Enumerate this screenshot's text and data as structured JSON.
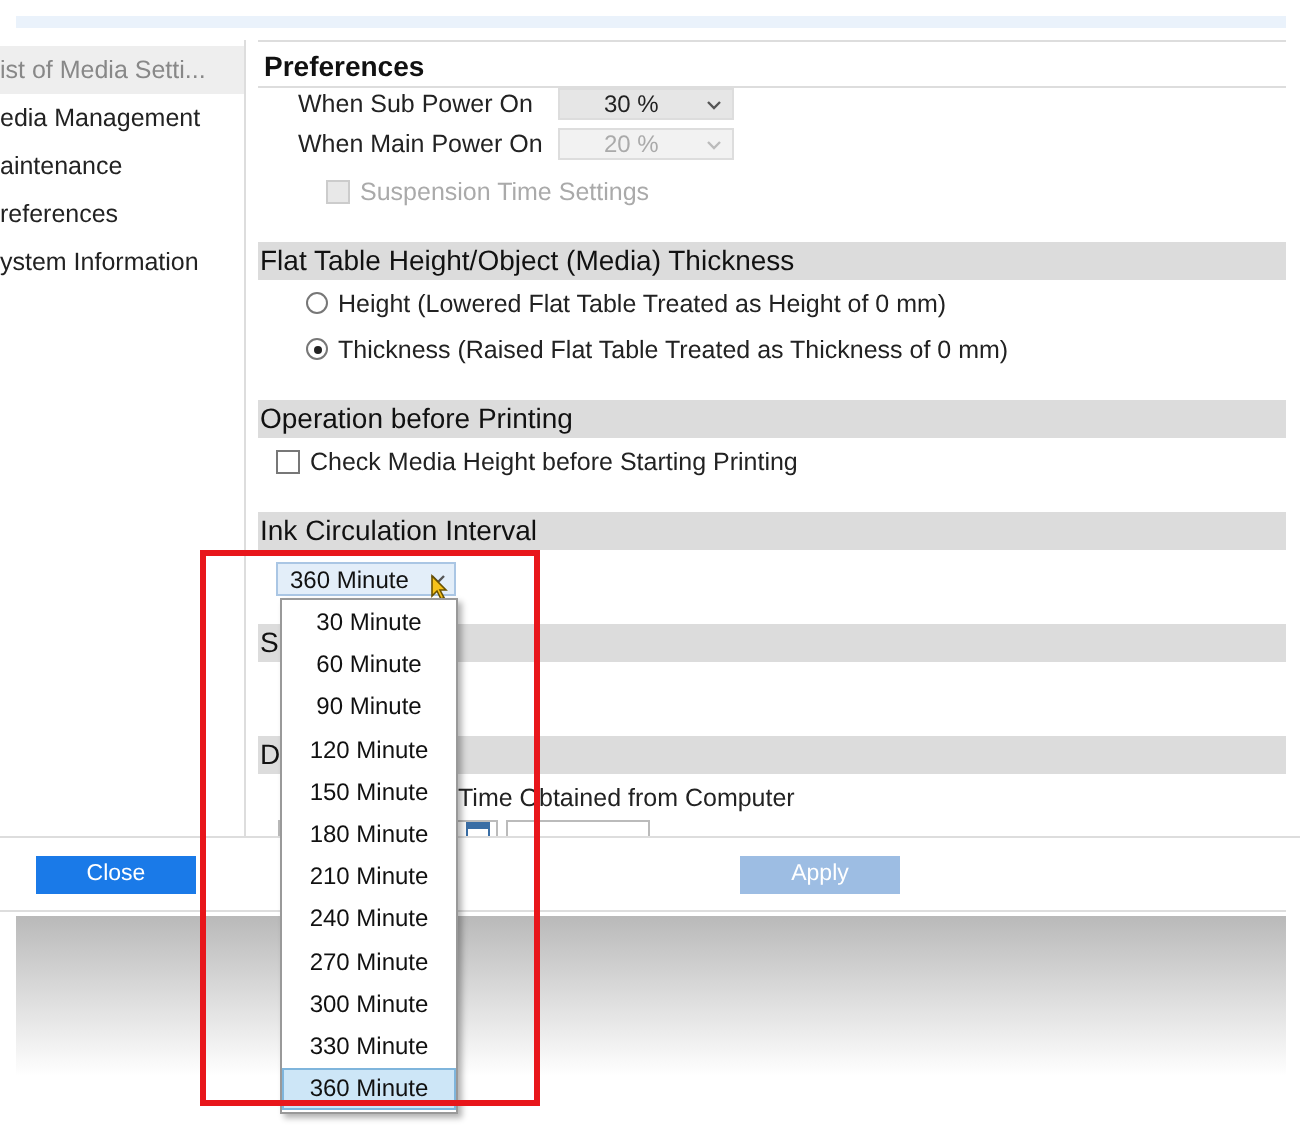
{
  "sidebar": {
    "items": [
      {
        "label": "ist of Media Setti...",
        "selected": true
      },
      {
        "label": "edia Management",
        "selected": false
      },
      {
        "label": "aintenance",
        "selected": false
      },
      {
        "label": "references",
        "selected": false
      },
      {
        "label": "ystem Information",
        "selected": false
      }
    ]
  },
  "panel": {
    "title": "Preferences",
    "power_rows": [
      {
        "label": "When Sub Power On",
        "value": "30 %",
        "disabled": false
      },
      {
        "label": "When Main Power On",
        "value": "20 %",
        "disabled": true
      }
    ],
    "suspension": {
      "label": "Suspension Time Settings",
      "checked": false,
      "disabled": true
    },
    "sections": [
      {
        "title": "Flat Table Height/Object (Media) Thickness",
        "kind": "radios",
        "options": [
          {
            "label": "Height (Lowered Flat Table Treated as Height of 0 mm)",
            "selected": false
          },
          {
            "label": "Thickness (Raised Flat Table Treated as Thickness of 0 mm)",
            "selected": true
          }
        ]
      },
      {
        "title": "Operation before Printing",
        "kind": "checkbox",
        "options": [
          {
            "label": "Check Media Height before Starting Printing",
            "checked": false
          }
        ]
      },
      {
        "title": "Ink Circulation Interval",
        "kind": "select",
        "value": "360 Minute",
        "expanded": true,
        "options": [
          {
            "label": "30 Minute",
            "selected": false
          },
          {
            "label": "60 Minute",
            "selected": false
          },
          {
            "label": "90 Minute",
            "selected": false
          },
          {
            "label": "120 Minute",
            "selected": false
          },
          {
            "label": "150 Minute",
            "selected": false
          },
          {
            "label": "180 Minute",
            "selected": false
          },
          {
            "label": "210 Minute",
            "selected": false
          },
          {
            "label": "240 Minute",
            "selected": false
          },
          {
            "label": "270 Minute",
            "selected": false
          },
          {
            "label": "300 Minute",
            "selected": false
          },
          {
            "label": "330 Minute",
            "selected": false
          },
          {
            "label": "360 Minute",
            "selected": true
          }
        ]
      },
      {
        "title": "S",
        "kind": "blank"
      },
      {
        "title": "D",
        "kind": "datetime",
        "checkbox_label": "Time Obtained from Computer"
      }
    ]
  },
  "footer": {
    "close": "Close",
    "apply": "Apply",
    "apply_disabled": true
  }
}
